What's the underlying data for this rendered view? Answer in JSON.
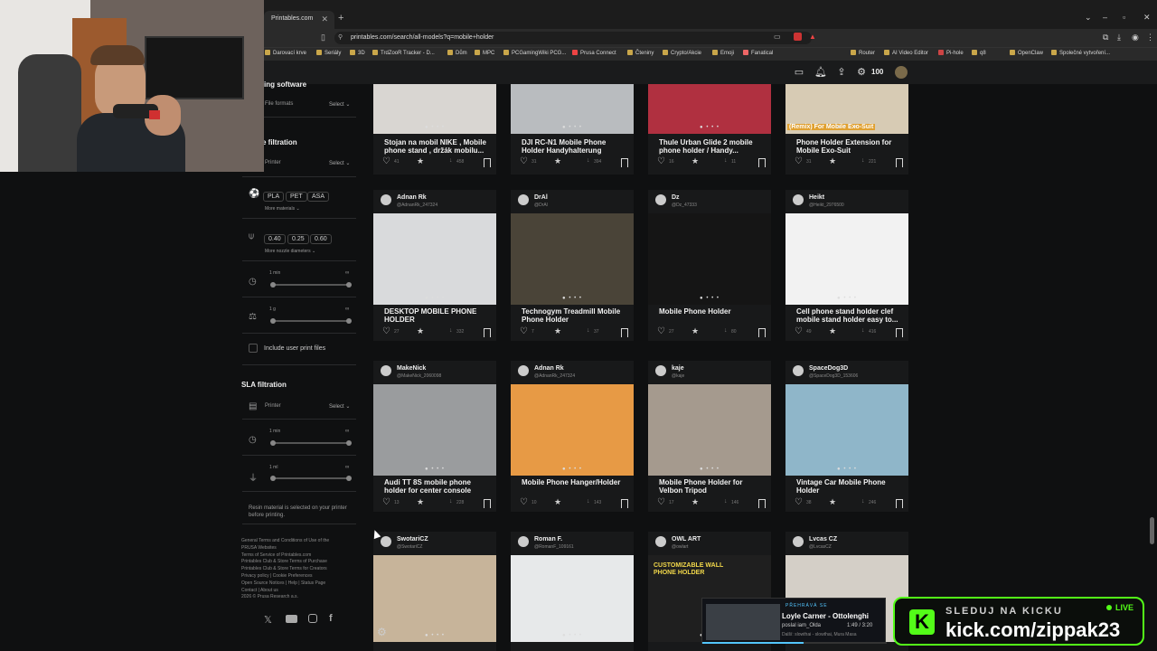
{
  "browser": {
    "tab_title": "Printables.com",
    "url": "printables.com/search/all-models?q=mobile+holder",
    "bookmarks": [
      "Darovací krve",
      "Seriály",
      "3D",
      "TrdZooR Tracker - D...",
      "Dům",
      "MPC",
      "PCGamingWiki PCG...",
      "Prusa Connect",
      "Čteniny",
      "Crypto/Akcie",
      "Emoji",
      "Fanatical",
      "Router",
      "AI Video Editor",
      "Pi-hole",
      "q8",
      "OpenClaw",
      "Společné vytvoření..."
    ]
  },
  "header": {
    "points": "100"
  },
  "sidebar": {
    "sections": {
      "slicing_software": "ing software",
      "file_formats": "File formats",
      "fdm_filtration": "e filtration",
      "printer": "Printer",
      "more_materials": "More materials",
      "more_nozzle": "More nozzle diameters",
      "include_user": "Include user print files",
      "sla_filtration": "SLA filtration",
      "sla_printer": "Printer",
      "resin_note": "Resin material is selected on your printer before printing."
    },
    "select_label": "Select",
    "materials": [
      "PLA",
      "PET",
      "ASA"
    ],
    "nozzles": [
      "0.40",
      "0.25",
      "0.60"
    ],
    "time_min": "1 min",
    "weight_min": "1 g",
    "sla_time_min": "1 min",
    "sla_volume_min": "1 ml",
    "infinity": "∞",
    "footer": [
      "General Terms and Conditions of Use of the",
      "PRUSA Websites",
      "Terms of Service of Printables.com",
      "Printables Club & Store Terms of Purchase",
      "Printables Club & Store Terms for Creators",
      "Privacy policy  |  Cookie Preferences",
      "Open Source Notices  |  Help  |  Status Page",
      "Contact  |  About us",
      "2026 © Prusa Research a.s."
    ]
  },
  "cards": [
    {
      "title": "Stojan na mobil NIKE , Mobile phone stand , držák mobilu...",
      "likes": "41",
      "dl": "458",
      "thumb": "#d9d6d2"
    },
    {
      "title": "DJI RC-N1 Mobile Phone Holder Handyhalterung",
      "likes": "31",
      "dl": "394",
      "thumb": "#b9bcbf"
    },
    {
      "title": "Thule Urban Glide 2 mobile phone holder / Handy...",
      "likes": "16",
      "dl": "11",
      "thumb": "#b03040"
    },
    {
      "title": "Phone Holder Extension for Mobile Exo-Suit",
      "likes": "31",
      "dl": "221",
      "thumb": "#d7cbb4",
      "remix": "(Remix) For Mobile Exo-Suit"
    },
    {
      "author": "Adnan Rk",
      "handle": "@AdnanRk_247324",
      "title": "DESKTOP MOBILE PHONE HOLDER",
      "likes": "27",
      "dl": "332",
      "thumb": "#d9dadc"
    },
    {
      "author": "DrAl",
      "handle": "@DrAl",
      "title": "Technogym Treadmill Mobile Phone Holder",
      "likes": "7",
      "dl": "37",
      "thumb": "#4a4438"
    },
    {
      "author": "Dz",
      "handle": "@Dz_47333",
      "title": "Mobile Phone Holder",
      "likes": "27",
      "dl": "80",
      "thumb": "#151515"
    },
    {
      "author": "Heikt",
      "handle": "@Heikt_2976500",
      "title": "Cell phone stand holder clef mobile stand holder easy to...",
      "likes": "49",
      "dl": "416",
      "thumb": "#f2f2f2"
    },
    {
      "author": "MakeNick",
      "handle": "@MakeNick_2060098",
      "title": "Audi TT 8S mobile phone holder for center console",
      "likes": "13",
      "dl": "228",
      "thumb": "#9a9c9e"
    },
    {
      "author": "Adnan Rk",
      "handle": "@AdnanRk_247324",
      "title": "Mobile Phone Hanger/Holder",
      "likes": "10",
      "dl": "143",
      "thumb": "#e79a45"
    },
    {
      "author": "kaje",
      "handle": "@kaje",
      "title": "Mobile Phone Holder for Velbon Tripod",
      "likes": "17",
      "dl": "146",
      "thumb": "#a59a8e"
    },
    {
      "author": "SpaceDog3D",
      "handle": "@SpaceDog3D_153606",
      "title": "Vintage Car Mobile Phone Holder",
      "likes": "38",
      "dl": "246",
      "thumb": "#8fb6c9"
    },
    {
      "author": "SwotariCZ",
      "handle": "@SwotariCZ",
      "title": "",
      "likes": "",
      "dl": "",
      "thumb": "#c7b49a"
    },
    {
      "author": "Roman F.",
      "handle": "@RomanF_109161",
      "title": "",
      "likes": "",
      "dl": "",
      "thumb": "#e7e9ea"
    },
    {
      "author": "OWL ART",
      "handle": "@owlart",
      "title": "",
      "likes": "",
      "dl": "",
      "thumb": "#1f1f1f",
      "promo": "CUSTOMIZABLE WALL PHONE HOLDER"
    },
    {
      "author": "Lvcas CZ",
      "handle": "@LvcasCZ",
      "title": "",
      "likes": "",
      "dl": "",
      "thumb": "#d4cfc7"
    }
  ],
  "overlay": {
    "now_playing": "PŘEHRÁVÁ SE",
    "song": "Loyle Carner - Ottolenghi",
    "requester": "poslal iam_Olda",
    "time": "1:49 / 3:20",
    "next": "Další: slowthai - slowthai, Mura Masa",
    "kick_label": "SLEDUJ NA KICKU",
    "kick_url": "kick.com/zippak23",
    "live": "LIVE",
    "kick_letter": "K"
  },
  "colors": {
    "accent": "#ee6b2b",
    "kick": "#53fc18"
  }
}
